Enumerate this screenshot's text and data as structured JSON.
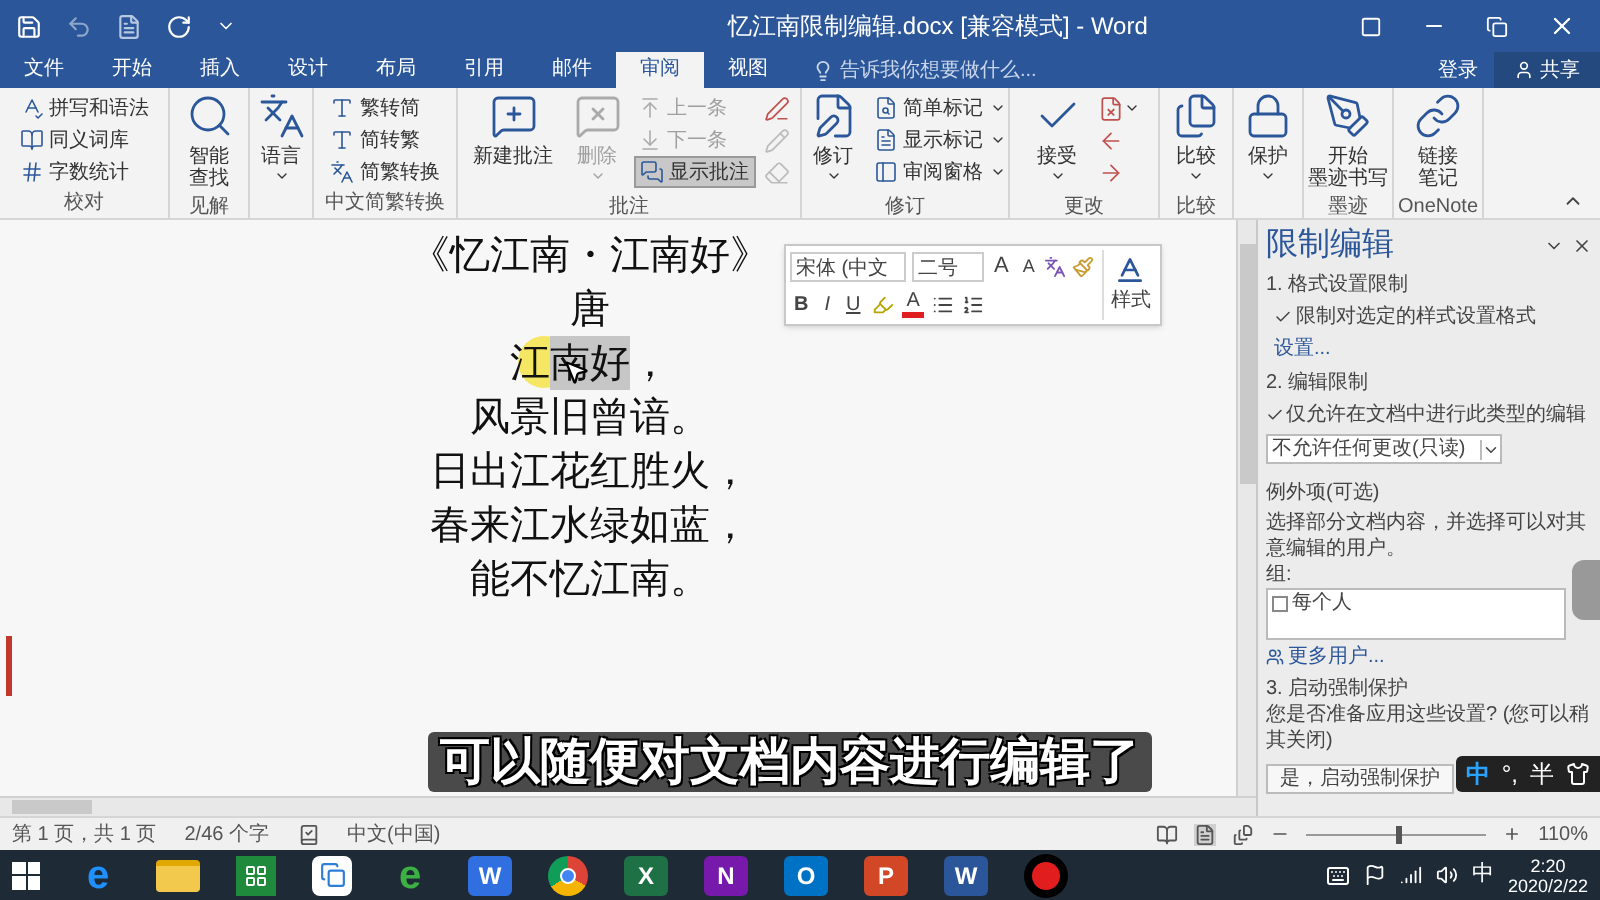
{
  "title_bar": {
    "title": "忆江南限制编辑.docx [兼容模式] - Word"
  },
  "tabs": [
    {
      "label": "文件",
      "selected": false
    },
    {
      "label": "开始",
      "selected": false
    },
    {
      "label": "插入",
      "selected": false
    },
    {
      "label": "设计",
      "selected": false
    },
    {
      "label": "布局",
      "selected": false
    },
    {
      "label": "引用",
      "selected": false
    },
    {
      "label": "邮件",
      "selected": false
    },
    {
      "label": "审阅",
      "selected": true
    },
    {
      "label": "视图",
      "selected": false
    }
  ],
  "tell_me": {
    "placeholder": "告诉我你想要做什么..."
  },
  "account": {
    "sign_in": "登录",
    "share": "共享"
  },
  "ribbon": [
    {
      "label": "校对",
      "items": [
        {
          "kind": "small",
          "label": "拼写和语法"
        },
        {
          "kind": "small",
          "label": "同义词库"
        },
        {
          "kind": "small",
          "label": "字数统计"
        }
      ]
    },
    {
      "label": "见解",
      "items": [
        {
          "kind": "large",
          "lines": [
            "智能",
            "查找"
          ],
          "dropdown": false
        }
      ]
    },
    {
      "items": [
        {
          "kind": "large",
          "lines": [
            "语言"
          ],
          "dropdown": true
        }
      ]
    },
    {
      "label": "中文简繁转换",
      "items": [
        {
          "kind": "small",
          "label": "繁转简"
        },
        {
          "kind": "small",
          "label": "简转繁"
        },
        {
          "kind": "small",
          "label": "简繁转换"
        }
      ]
    },
    {
      "label": "批注",
      "items": [
        {
          "kind": "large",
          "lines": [
            "新建批注"
          ],
          "disabled": false,
          "pressed": false,
          "dropdown": false
        },
        {
          "kind": "large",
          "lines": [
            "删除"
          ],
          "disabled": true,
          "pressed": false,
          "dropdown": true
        },
        {
          "kind": "small",
          "label": "上一条",
          "disabled": true,
          "pressed": false
        },
        {
          "kind": "small",
          "label": "下一条",
          "disabled": true,
          "pressed": false
        },
        {
          "kind": "small",
          "label": "显示批注",
          "disabled": false,
          "pressed": true
        },
        {
          "kind": "icon",
          "disabled": false,
          "pressed": false
        },
        {
          "kind": "icon",
          "disabled": true,
          "pressed": false
        },
        {
          "kind": "icon",
          "disabled": true,
          "pressed": false
        }
      ]
    },
    {
      "label": "修订",
      "items": [
        {
          "kind": "large",
          "lines": [
            "修订"
          ],
          "dropdown": true
        },
        {
          "kind": "small",
          "label": "简单标记",
          "dropdown": true
        },
        {
          "kind": "small",
          "label": "显示标记",
          "dropdown": true
        },
        {
          "kind": "small",
          "label": "审阅窗格",
          "dropdown": true
        }
      ]
    },
    {
      "label": "更改",
      "items": [
        {
          "kind": "large",
          "lines": [
            "接受"
          ],
          "dropdown": true
        },
        {
          "kind": "icon",
          "dropdown": true
        },
        {
          "kind": "icon",
          "dropdown": false
        },
        {
          "kind": "icon",
          "dropdown": false
        }
      ]
    },
    {
      "label": "比较",
      "items": [
        {
          "kind": "large",
          "lines": [
            "比较"
          ],
          "dropdown": true
        }
      ]
    },
    {
      "items": [
        {
          "kind": "large",
          "lines": [
            "保护"
          ],
          "dropdown": true
        }
      ]
    },
    {
      "label": "墨迹",
      "items": [
        {
          "kind": "large",
          "lines": [
            "开始",
            "墨迹书写"
          ],
          "dropdown": false
        }
      ]
    },
    {
      "label": "OneNote",
      "items": [
        {
          "kind": "large",
          "lines": [
            "链接",
            "笔记"
          ],
          "dropdown": false
        }
      ]
    }
  ],
  "document": {
    "lines": [
      {
        "segments": [
          {
            "text": "《忆江南・江南好》",
            "selected": false
          }
        ]
      },
      {
        "segments": [
          {
            "text": "唐",
            "selected": false
          }
        ]
      },
      {
        "segments": [
          {
            "text": "江",
            "selected": false
          },
          {
            "text": "南好",
            "selected": true
          },
          {
            "text": "，",
            "selected": false
          }
        ]
      },
      {
        "segments": [
          {
            "text": "风景旧曾谙。",
            "selected": false
          }
        ]
      },
      {
        "segments": [
          {
            "text": "日出江花红胜火，",
            "selected": false
          }
        ]
      },
      {
        "segments": [
          {
            "text": "春来江水绿如蓝，",
            "selected": false
          }
        ]
      },
      {
        "segments": [
          {
            "text": "能不忆江南。",
            "selected": false
          }
        ]
      }
    ]
  },
  "mini_toolbar": {
    "font": "宋体 (中文",
    "size": "二号",
    "grow": "A",
    "shrink": "A",
    "bold": "B",
    "italic": "I",
    "underline": "U",
    "font_color": "A",
    "styles": "样式"
  },
  "pane": {
    "title": "限制编辑",
    "section_1": {
      "heading": "1. 格式设置限制",
      "checkbox": {
        "label": "限制对选定的样式设置格式",
        "checked": true
      },
      "link": "设置..."
    },
    "section_2": {
      "heading": "2. 编辑限制",
      "checkbox": {
        "label": "仅允许在文档中进行此类型的编辑",
        "checked": true
      },
      "select": "不允许任何更改(只读)",
      "exceptions_heading": "例外项(可选)",
      "description": [
        "选择部分文档内容，并选择可以对其",
        "意编辑的用户。"
      ],
      "groups_label": "组:",
      "groups": [
        {
          "label": "每个人",
          "checked": false
        }
      ],
      "more_users": "更多用户..."
    },
    "section_3": {
      "heading": "3. 启动强制保护",
      "question": [
        "您是否准备应用这些设置? (您可以稍",
        "其关闭)"
      ],
      "button": "是，启动强制保护"
    }
  },
  "ime": {
    "mode": "中",
    "punct": "°,",
    "width": "半"
  },
  "subtitle": "可以随便对文档内容进行编辑了",
  "status_bar": {
    "page": "第 1 页，共 1 页",
    "words": "2/46 个字",
    "language": "中文(中国)",
    "zoom": {
      "level": 0.5,
      "reading": "110%"
    }
  },
  "taskbar": {
    "apps": [
      {
        "kind": "ie",
        "glyph": "e"
      },
      {
        "kind": "folder"
      },
      {
        "kind": "store"
      },
      {
        "kind": "cloud"
      },
      {
        "kind": "ie360",
        "glyph": "e"
      },
      {
        "kind": "wps",
        "glyph": "W"
      },
      {
        "kind": "chrome"
      },
      {
        "kind": "excel",
        "glyph": "X"
      },
      {
        "kind": "onenote",
        "glyph": "N"
      },
      {
        "kind": "outlook",
        "glyph": "O"
      },
      {
        "kind": "powerpoint",
        "glyph": "P"
      },
      {
        "kind": "word",
        "glyph": "W"
      },
      {
        "kind": "record"
      }
    ],
    "ime": "中",
    "time": "2:20",
    "date": "2020/2/22"
  }
}
